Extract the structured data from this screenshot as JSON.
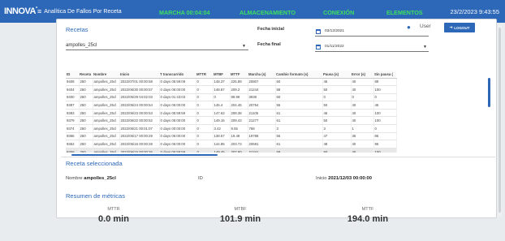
{
  "header": {
    "logo": "INNOVA",
    "logo_mark": "°",
    "title": "Analítica De Fallos Por Receta",
    "statuses": [
      "MARCHA 00:04:04",
      "ALMACENAMIENTO",
      "CONEXIÓN",
      "ELEMENTOS"
    ],
    "datetime": "23/2/2023 9:43:55",
    "status_color": "#3ee05f",
    "bar_color": "#2d67b8"
  },
  "filters": {
    "recipes_title": "Recetas",
    "recipe_value": "ampolles_25cl",
    "start_label": "Fecha inicial",
    "start_value": "03/12/2021",
    "end_label": "Fecha final",
    "end_value": "01/11/2022"
  },
  "user": {
    "label": "User",
    "logout": "LOGOUT"
  },
  "table": {
    "columns": [
      "ID",
      "Receta",
      "Nombre",
      "Inicio",
      "T transcurrido",
      "MTTR",
      "MTBF",
      "MTTF",
      "Marcha (s)",
      "Cambio formato (s)",
      "Pausa (s)",
      "Error (s)",
      "Sin pausa ("
    ],
    "rows": [
      [
        "9408",
        "250",
        "ampolles_25cl",
        "2022/07/01 00:00:58",
        "0 days 05:59:09",
        "0",
        "148.37",
        "225.89",
        "20807",
        "60",
        "46",
        "40",
        "89"
      ],
      [
        "9404",
        "250",
        "ampolles_25cl",
        "2022/06/30 00:00:57",
        "0 days 06:00:00",
        "0",
        "148.87",
        "209.2",
        "21244",
        "58",
        "50",
        "40",
        "100"
      ],
      [
        "9400",
        "250",
        "ampolles_25cl",
        "2022/06/29 04:02:03",
        "0 days 01:43:03",
        "0",
        "0",
        "99.99",
        "3939",
        "60",
        "0",
        "0",
        "0"
      ],
      [
        "9387",
        "250",
        "ampolles_25cl",
        "2022/06/24 00:00:54",
        "0 days 06:00:00",
        "0",
        "145.4",
        "204.45",
        "20754",
        "55",
        "50",
        "40",
        "46"
      ],
      [
        "9383",
        "250",
        "ampolles_25cl",
        "2022/06/23 00:00:53",
        "0 days 05:59:59",
        "0",
        "147.63",
        "208.38",
        "21105",
        "61",
        "46",
        "40",
        "100"
      ],
      [
        "9379",
        "250",
        "ampolles_25cl",
        "2022/06/22 00:00:52",
        "0 days 06:00:00",
        "0",
        "149.16",
        "209.43",
        "21277",
        "61",
        "50",
        "40",
        "100"
      ],
      [
        "9374",
        "250",
        "ampolles_25cl",
        "2022/06/21 00:01:07",
        "0 days 00:00:00",
        "0",
        "3.42",
        "9.55",
        "768",
        "3",
        "3",
        "1",
        "0"
      ],
      [
        "9366",
        "250",
        "ampolles_25cl",
        "2022/06/17 00:00:29",
        "0 days 06:00:00",
        "0",
        "138.57",
        "19.48",
        "19788",
        "56",
        "47",
        "35",
        "86"
      ],
      [
        "9362",
        "250",
        "ampolles_25cl",
        "2022/06/16 00:00:28 ",
        "0 days 06:00:00",
        "0",
        "144.85",
        "203.73",
        "20681",
        "61",
        "48",
        "40",
        "96"
      ],
      [
        "9358",
        "250",
        "ampolles_25cl",
        "2022/06/15 00:00:26",
        "0 days 05:59:59",
        "0",
        "149.45",
        "207.80",
        "21241",
        "58",
        "50",
        "40",
        "100"
      ]
    ]
  },
  "selected": {
    "title": "Receta seleccionada",
    "name_label": "Nombre",
    "name_value": "ampolles_25cl",
    "id_label": "ID",
    "start_label": "Inicio",
    "start_value": "2021/12/03 00:00:00"
  },
  "metrics": {
    "title": "Resumen de métricas",
    "items": [
      {
        "label": "MTTR",
        "value": "0.0 min"
      },
      {
        "label": "MTBF",
        "value": "101.9 min"
      },
      {
        "label": "MTTF",
        "value": "194.0 min"
      }
    ]
  }
}
